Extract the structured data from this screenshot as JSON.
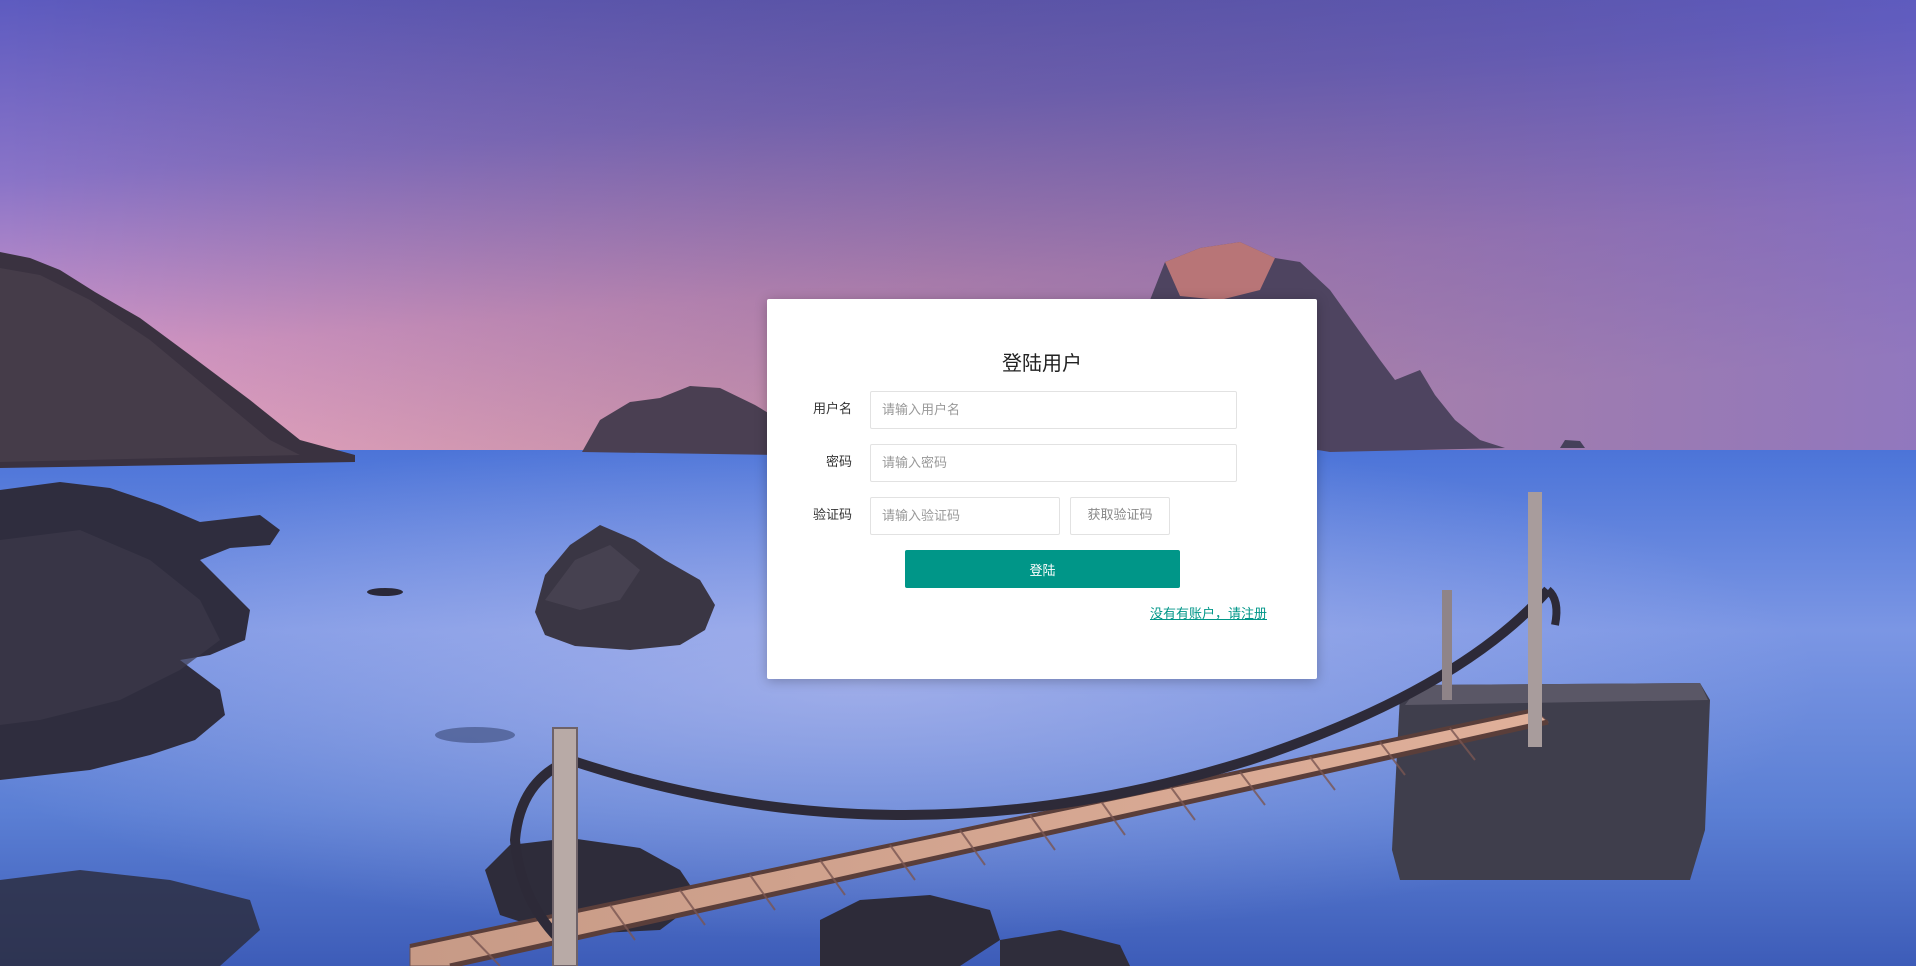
{
  "login": {
    "title": "登陆用户",
    "username": {
      "label": "用户名",
      "placeholder": "请输入用户名",
      "value": ""
    },
    "password": {
      "label": "密码",
      "placeholder": "请输入密码",
      "value": ""
    },
    "captcha": {
      "label": "验证码",
      "placeholder": "请输入验证码",
      "value": "",
      "get_code_label": "获取验证码"
    },
    "submit_label": "登陆",
    "register_link": "没有有账户，请注册"
  },
  "colors": {
    "accent": "#009688",
    "card_bg": "#ffffff",
    "sky_top": "#6a5fbe",
    "sky_horizon": "#f1a8cc",
    "sea": "#5a86e0"
  }
}
